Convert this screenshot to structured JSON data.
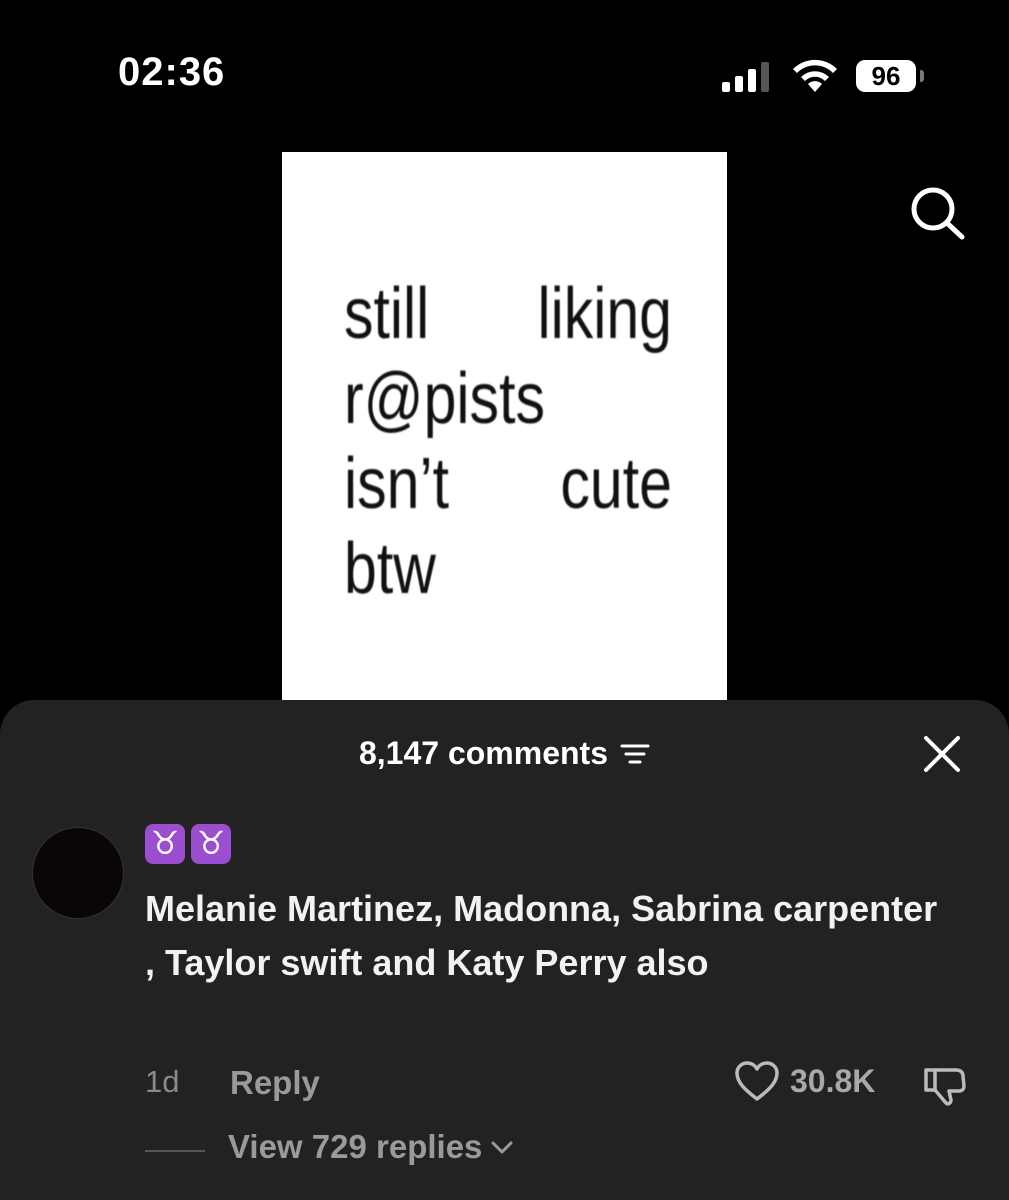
{
  "status_bar": {
    "time": "02:36",
    "battery_level": "96",
    "signal_icon": "signal-bars-icon",
    "wifi_icon": "wifi-icon"
  },
  "header": {
    "search_icon": "search-icon"
  },
  "video": {
    "caption_lines": [
      [
        "still",
        "liking"
      ],
      [
        "r@pists",
        ""
      ],
      [
        "isn’t",
        "cute"
      ],
      [
        "btw",
        ""
      ]
    ]
  },
  "comments_sheet": {
    "count_label": "8,147 comments",
    "filter_icon": "filter-icon",
    "close_icon": "close-icon",
    "background_color": "#222222"
  },
  "comment": {
    "username_emojis": [
      "♉",
      "♉"
    ],
    "text": "Melanie Martinez, Madonna, Sabrina carpenter , Taylor swift and Katy Perry also",
    "time_ago": "1d",
    "reply_label": "Reply",
    "like_count": "30.8K",
    "view_replies_label": "View 729 replies",
    "emoji_color": "#9b4fd0"
  }
}
